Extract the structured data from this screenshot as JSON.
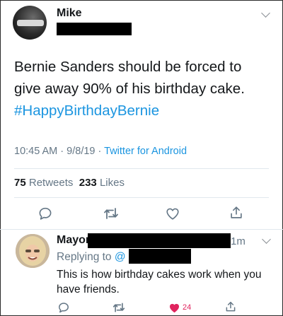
{
  "tweet": {
    "author_name": "Mike",
    "text": "Bernie Sanders should be forced to give away 90% of his birthday cake.",
    "hashtag": "#HappyBirthdayBernie",
    "time": "10:45 AM",
    "separator": "·",
    "date": "9/8/19",
    "source": "Twitter for Android",
    "retweet_count": "75",
    "retweets_label": "Retweets",
    "like_count": "233",
    "likes_label": "Likes"
  },
  "reply": {
    "author_name": "Mayor",
    "time": "1m",
    "replying_to_label": "Replying to",
    "replying_to_handle": "@",
    "text": "This is how birthday cakes work when you have friends.",
    "like_count": "24"
  },
  "colors": {
    "accent": "#1b95e0",
    "muted": "#657786",
    "text": "#14171a",
    "like": "#e0245e",
    "divider": "#e1e8ed"
  },
  "icons": {
    "reply": "reply-icon",
    "retweet": "retweet-icon",
    "like": "heart-icon",
    "share": "share-icon",
    "more": "chevron-down-icon"
  }
}
